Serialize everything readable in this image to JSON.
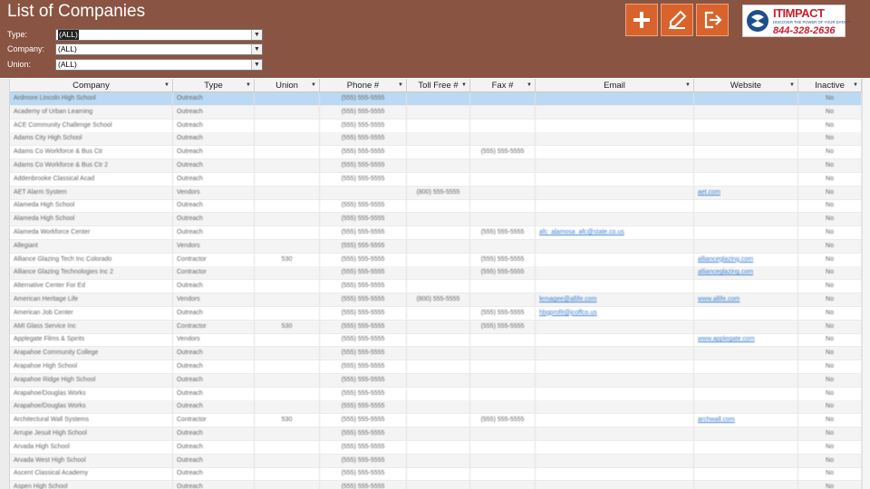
{
  "title": "List of Companies",
  "filters": [
    {
      "label": "Type:",
      "value": "(ALL)",
      "selected": true
    },
    {
      "label": "Company:",
      "value": "(ALL)",
      "selected": false
    },
    {
      "label": "Union:",
      "value": "(ALL)",
      "selected": false
    }
  ],
  "toolbar": [
    {
      "name": "add-button",
      "icon": "plus-icon"
    },
    {
      "name": "edit-button",
      "icon": "pencil-icon"
    },
    {
      "name": "exit-button",
      "icon": "exit-icon"
    }
  ],
  "logo": {
    "brand": "ITIMPACT",
    "tagline": "DISCOVER THE POWER OF YOUR DATA!™",
    "phone": "844-328-2636",
    "brand_color": "#c8202f"
  },
  "colors": {
    "header_bg": "#8a5442",
    "button_bg": "#d9632c",
    "selection": "#bcd9f3",
    "link": "#3b7fd2"
  },
  "columns": [
    "Company",
    "Type",
    "Union",
    "Phone #",
    "Toll Free #",
    "Fax #",
    "Email",
    "Website",
    "Inactive"
  ],
  "rows": [
    {
      "company": "Ardmore Lincoln High School",
      "type": "Outreach",
      "union": "",
      "phone": "(555) 555-5555",
      "tollfree": "",
      "fax": "",
      "email": "",
      "website": "",
      "inactive": "No"
    },
    {
      "company": "Academy of Urban Learning",
      "type": "Outreach",
      "union": "",
      "phone": "(555) 555-5555",
      "tollfree": "",
      "fax": "",
      "email": "",
      "website": "",
      "inactive": "No"
    },
    {
      "company": "ACE Community Challenge School",
      "type": "Outreach",
      "union": "",
      "phone": "(555) 555-5555",
      "tollfree": "",
      "fax": "",
      "email": "",
      "website": "",
      "inactive": "No"
    },
    {
      "company": "Adams City High School",
      "type": "Outreach",
      "union": "",
      "phone": "(555) 555-5555",
      "tollfree": "",
      "fax": "",
      "email": "",
      "website": "",
      "inactive": "No"
    },
    {
      "company": "Adams Co Workforce & Bus Ctr",
      "type": "Outreach",
      "union": "",
      "phone": "(555) 555-5555",
      "tollfree": "",
      "fax": "(555) 555-5555",
      "email": "",
      "website": "",
      "inactive": "No"
    },
    {
      "company": "Adams Co Workforce & Bus Ctr 2",
      "type": "Outreach",
      "union": "",
      "phone": "(555) 555-5555",
      "tollfree": "",
      "fax": "",
      "email": "",
      "website": "",
      "inactive": "No"
    },
    {
      "company": "Addenbrooke Classical Acad",
      "type": "Outreach",
      "union": "",
      "phone": "(555) 555-5555",
      "tollfree": "",
      "fax": "",
      "email": "",
      "website": "",
      "inactive": "No"
    },
    {
      "company": "AET Alarm System",
      "type": "Vendors",
      "union": "",
      "phone": "",
      "tollfree": "(800) 555-5555",
      "fax": "",
      "email": "",
      "website": "aet.com",
      "inactive": "No"
    },
    {
      "company": "Alameda High School",
      "type": "Outreach",
      "union": "",
      "phone": "(555) 555-5555",
      "tollfree": "",
      "fax": "",
      "email": "",
      "website": "",
      "inactive": "No"
    },
    {
      "company": "Alameda High School",
      "type": "Outreach",
      "union": "",
      "phone": "(555) 555-5555",
      "tollfree": "",
      "fax": "",
      "email": "",
      "website": "",
      "inactive": "No"
    },
    {
      "company": "Alameda Workforce Center",
      "type": "Outreach",
      "union": "",
      "phone": "(555) 555-5555",
      "tollfree": "",
      "fax": "(555) 555-5555",
      "email": "afc_alamosa_afc@state.co.us",
      "website": "",
      "inactive": "No"
    },
    {
      "company": "Allegiant",
      "type": "Vendors",
      "union": "",
      "phone": "(555) 555-5555",
      "tollfree": "",
      "fax": "",
      "email": "",
      "website": "",
      "inactive": "No"
    },
    {
      "company": "Alliance Glazing Tech Inc Colorado",
      "type": "Contractor",
      "union": "530",
      "phone": "(555) 555-5555",
      "tollfree": "",
      "fax": "(555) 555-5555",
      "email": "",
      "website": "allianceglazing.com",
      "inactive": "No"
    },
    {
      "company": "Alliance Glazing Technologies Inc 2",
      "type": "Contractor",
      "union": "",
      "phone": "(555) 555-5555",
      "tollfree": "",
      "fax": "(555) 555-5555",
      "email": "",
      "website": "allianceglazing.com",
      "inactive": "No"
    },
    {
      "company": "Alternative Center For Ed",
      "type": "Outreach",
      "union": "",
      "phone": "(555) 555-5555",
      "tollfree": "",
      "fax": "",
      "email": "",
      "website": "",
      "inactive": "No"
    },
    {
      "company": "American Heritage Life",
      "type": "Vendors",
      "union": "",
      "phone": "(555) 555-5555",
      "tollfree": "(800) 555-5555",
      "fax": "",
      "email": "lemagee@allife.com",
      "website": "www.allife.com",
      "inactive": "No"
    },
    {
      "company": "American Job Center",
      "type": "Outreach",
      "union": "",
      "phone": "(555) 555-5555",
      "tollfree": "",
      "fax": "(555) 555-5555",
      "email": "hbgprofit@jcoffco.us",
      "website": "",
      "inactive": "No"
    },
    {
      "company": "AMI Glass Service Inc",
      "type": "Contractor",
      "union": "530",
      "phone": "(555) 555-5555",
      "tollfree": "",
      "fax": "(555) 555-5555",
      "email": "",
      "website": "",
      "inactive": "No"
    },
    {
      "company": "Applegate Films & Spirits",
      "type": "Vendors",
      "union": "",
      "phone": "(555) 555-5555",
      "tollfree": "",
      "fax": "",
      "email": "",
      "website": "www.applegate.com",
      "inactive": "No"
    },
    {
      "company": "Arapahoe Community College",
      "type": "Outreach",
      "union": "",
      "phone": "(555) 555-5555",
      "tollfree": "",
      "fax": "",
      "email": "",
      "website": "",
      "inactive": "No"
    },
    {
      "company": "Arapahoe High School",
      "type": "Outreach",
      "union": "",
      "phone": "(555) 555-5555",
      "tollfree": "",
      "fax": "",
      "email": "",
      "website": "",
      "inactive": "No"
    },
    {
      "company": "Arapahoe Ridge High School",
      "type": "Outreach",
      "union": "",
      "phone": "(555) 555-5555",
      "tollfree": "",
      "fax": "",
      "email": "",
      "website": "",
      "inactive": "No"
    },
    {
      "company": "Arapahoe/Douglas Works",
      "type": "Outreach",
      "union": "",
      "phone": "(555) 555-5555",
      "tollfree": "",
      "fax": "",
      "email": "",
      "website": "",
      "inactive": "No"
    },
    {
      "company": "Arapahoe/Douglas Works",
      "type": "Outreach",
      "union": "",
      "phone": "(555) 555-5555",
      "tollfree": "",
      "fax": "",
      "email": "",
      "website": "",
      "inactive": "No"
    },
    {
      "company": "Architectural Wall Systems",
      "type": "Contractor",
      "union": "530",
      "phone": "(555) 555-5555",
      "tollfree": "",
      "fax": "(555) 555-5555",
      "email": "",
      "website": "archwall.com",
      "inactive": "No"
    },
    {
      "company": "Arrupe Jesuit High School",
      "type": "Outreach",
      "union": "",
      "phone": "(555) 555-5555",
      "tollfree": "",
      "fax": "",
      "email": "",
      "website": "",
      "inactive": "No"
    },
    {
      "company": "Arvada High School",
      "type": "Outreach",
      "union": "",
      "phone": "(555) 555-5555",
      "tollfree": "",
      "fax": "",
      "email": "",
      "website": "",
      "inactive": "No"
    },
    {
      "company": "Arvada West High School",
      "type": "Outreach",
      "union": "",
      "phone": "(555) 555-5555",
      "tollfree": "",
      "fax": "",
      "email": "",
      "website": "",
      "inactive": "No"
    },
    {
      "company": "Ascent Classical Academy",
      "type": "Outreach",
      "union": "",
      "phone": "(555) 555-5555",
      "tollfree": "",
      "fax": "",
      "email": "",
      "website": "",
      "inactive": "No"
    },
    {
      "company": "Aspen High School",
      "type": "Outreach",
      "union": "",
      "phone": "(555) 555-5555",
      "tollfree": "",
      "fax": "",
      "email": "",
      "website": "",
      "inactive": "No"
    }
  ]
}
